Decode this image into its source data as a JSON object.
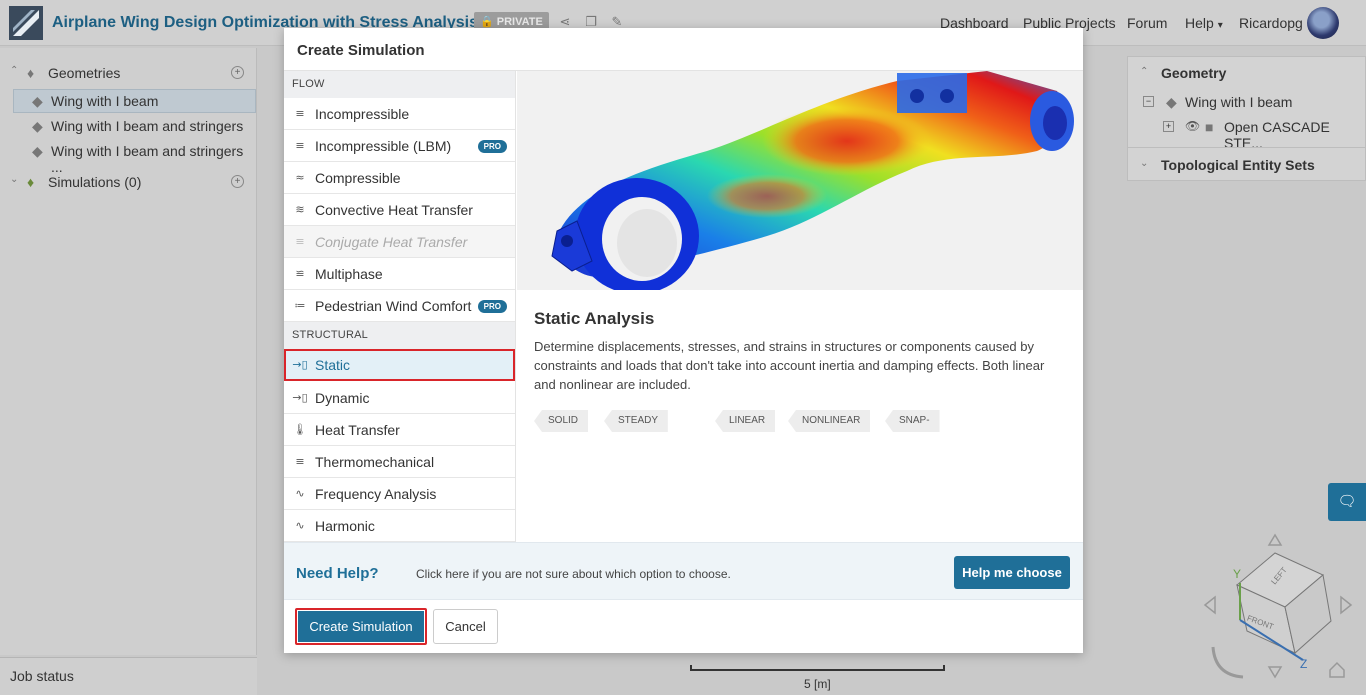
{
  "header": {
    "project_title": "Airplane Wing Design Optimization with Stress Analysis",
    "private_label": "PRIVATE",
    "nav": [
      "Dashboard",
      "Public Projects",
      "Forum",
      "Help",
      "Ricardopg"
    ]
  },
  "left_panel": {
    "geometries_label": "Geometries",
    "geometries": [
      "Wing with I beam",
      "Wing with I beam and stringers",
      "Wing with I beam and stringers ..."
    ],
    "simulations_label": "Simulations (0)",
    "job_status_label": "Job status"
  },
  "right_panel": {
    "geometry_label": "Geometry",
    "geometry_item": "Wing with I beam",
    "cad_item": "Open CASCADE STE...",
    "topo_label": "Topological Entity Sets"
  },
  "viewport": {
    "scale_label": "5 [m]",
    "cube_labels": [
      "LEFT",
      "FRONT"
    ],
    "axes": [
      "Y",
      "Z"
    ]
  },
  "modal": {
    "title": "Create Simulation",
    "flow_section": "FLOW",
    "flow_items": [
      {
        "label": "Incompressible",
        "icon": "flow-icon"
      },
      {
        "label": "Incompressible (LBM)",
        "icon": "flow-icon",
        "pro": "PRO"
      },
      {
        "label": "Compressible",
        "icon": "compressible-icon"
      },
      {
        "label": "Convective Heat Transfer",
        "icon": "convective-icon"
      },
      {
        "label": "Conjugate Heat Transfer",
        "icon": "conjugate-icon",
        "disabled": true
      },
      {
        "label": "Multiphase",
        "icon": "multiphase-icon"
      },
      {
        "label": "Pedestrian Wind Comfort",
        "icon": "wind-icon",
        "pro": "PRO"
      }
    ],
    "structural_section": "STRUCTURAL",
    "structural_items": [
      {
        "label": "Static",
        "icon": "static-icon",
        "selected": true
      },
      {
        "label": "Dynamic",
        "icon": "dynamic-icon"
      },
      {
        "label": "Heat Transfer",
        "icon": "thermometer-icon"
      },
      {
        "label": "Thermomechanical",
        "icon": "thermomechanical-icon"
      },
      {
        "label": "Frequency Analysis",
        "icon": "wave-icon"
      },
      {
        "label": "Harmonic",
        "icon": "harmonic-icon"
      }
    ],
    "detail": {
      "title": "Static Analysis",
      "description": "Determine displacements, stresses, and strains in structures or components caused by constraints and loads that don't take into account inertia and damping effects. Both linear and nonlinear are included.",
      "tags": [
        "SOLID",
        "STEADY LOADS",
        "LINEAR",
        "NONLINEAR",
        "SNAP-FIT"
      ]
    },
    "help": {
      "title": "Need Help?",
      "text": "Click here if you are not sure about which option to choose.",
      "button": "Help me choose"
    },
    "create_button": "Create Simulation",
    "cancel_button": "Cancel"
  },
  "colors": {
    "accent": "#1f6f98",
    "highlight": "#d9252a"
  }
}
